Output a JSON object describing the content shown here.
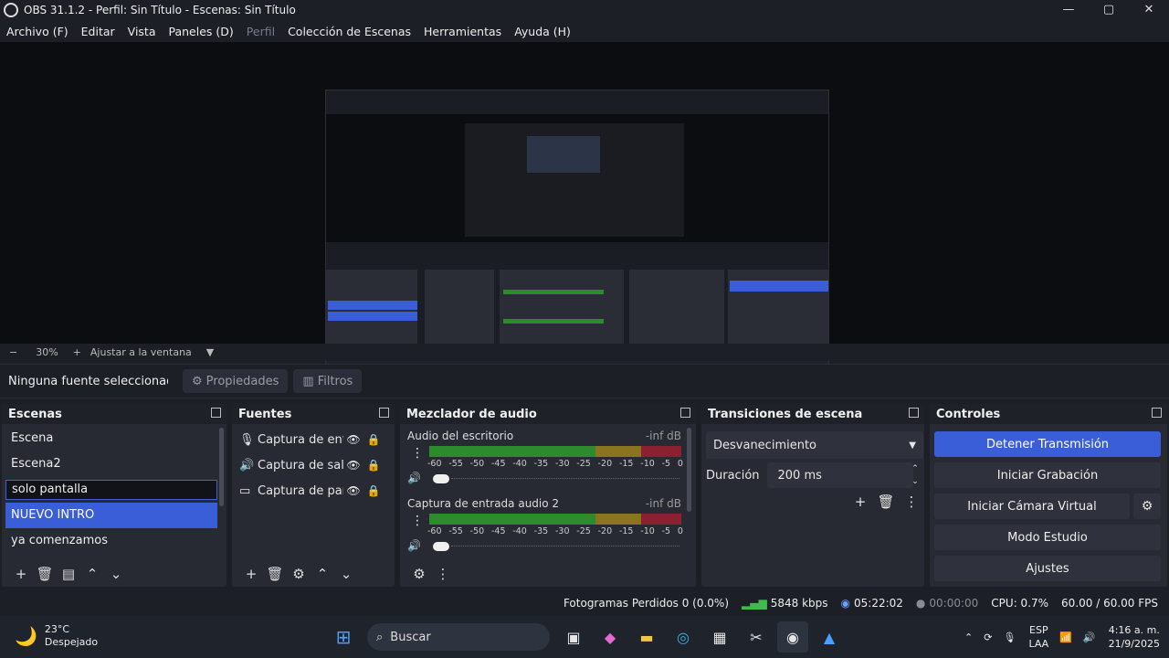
{
  "window": {
    "title": "OBS 31.1.2 - Perfil: Sin Título - Escenas: Sin Título",
    "controls": [
      "—",
      "▢",
      "✕"
    ]
  },
  "menu": [
    "Archivo (F)",
    "Editar",
    "Vista",
    "Paneles (D)",
    "Perfil",
    "Colección de Escenas",
    "Herramientas",
    "Ayuda (H)"
  ],
  "menu_disabled": "Perfil",
  "zoom": {
    "minus": "−",
    "value": "30%",
    "plus": "+",
    "fit": "Ajustar a la ventana"
  },
  "source_bar": {
    "none_selected": "Ninguna fuente seleccionada",
    "properties": "Propiedades",
    "filters": "Filtros"
  },
  "scenes": {
    "title": "Escenas",
    "items": [
      "Escena",
      "Escena2",
      "solo pantalla",
      "NUEVO INTRO",
      "ya comenzamos"
    ],
    "editing_index": 2,
    "selected_index": 3
  },
  "sources": {
    "title": "Fuentes",
    "items": [
      {
        "name": "Captura de entrada",
        "icon": "mic-icon"
      },
      {
        "name": "Captura de salida",
        "icon": "speaker-icon"
      },
      {
        "name": "Captura de pantalla",
        "icon": "monitor-icon"
      }
    ]
  },
  "mixer": {
    "title": "Mezclador de audio",
    "channels": [
      {
        "name": "Audio del escritorio",
        "level": "-inf dB"
      },
      {
        "name": "Captura de entrada audio 2",
        "level": "-inf dB"
      }
    ],
    "ticks": [
      "-60",
      "-55",
      "-50",
      "-45",
      "-40",
      "-35",
      "-30",
      "-25",
      "-20",
      "-15",
      "-10",
      "-5",
      "0"
    ]
  },
  "transitions": {
    "title": "Transiciones de escena",
    "selected": "Desvanecimiento",
    "duration_label": "Duración",
    "duration_value": "200 ms"
  },
  "controls": {
    "title": "Controles",
    "stop_stream": "Detener Transmisión",
    "start_record": "Iniciar Grabación",
    "virtual_cam": "Iniciar Cámara Virtual",
    "studio_mode": "Modo Estudio",
    "settings": "Ajustes"
  },
  "status": {
    "dropped": "Fotogramas Perdidos 0 (0.0%)",
    "bitrate": "5848 kbps",
    "stream_time": "05:22:02",
    "rec_time": "00:00:00",
    "cpu": "CPU: 0.7%",
    "fps": "60.00 / 60.00 FPS"
  },
  "taskbar": {
    "temp": "23°C",
    "weather": "Despejado",
    "search": "Buscar",
    "lang1": "ESP",
    "lang2": "LAA",
    "time": "4:16 a. m.",
    "date": "21/9/2025"
  },
  "colors": {
    "accent": "#3a5ed8",
    "meter_green": "#2d8a2d",
    "meter_yellow": "#8a7420",
    "meter_red": "#8a2030"
  }
}
